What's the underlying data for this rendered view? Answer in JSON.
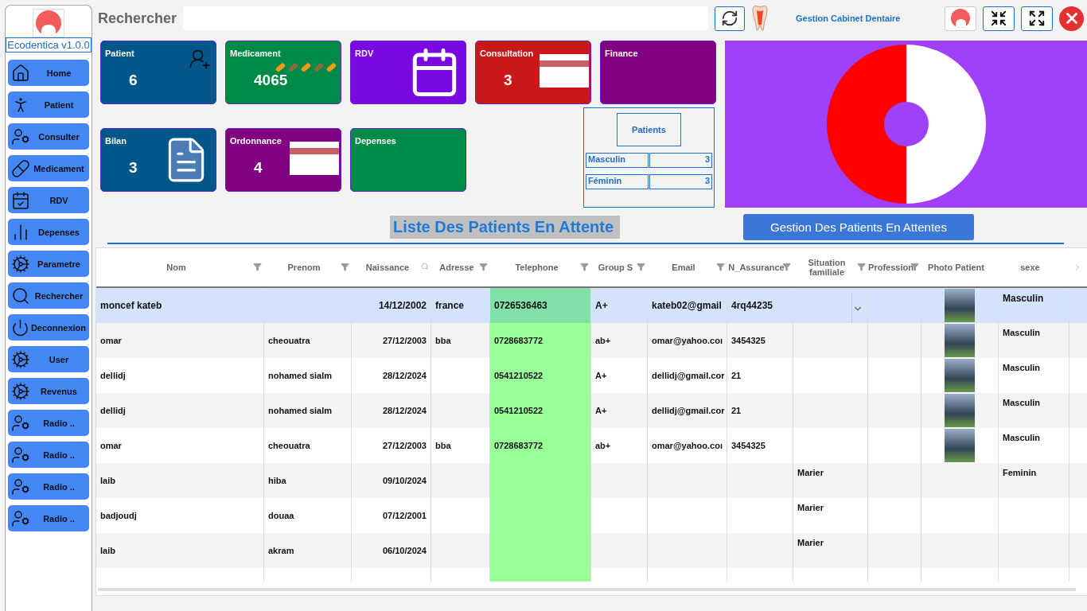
{
  "sidebar": {
    "version": "Ecodentica v1.0.0",
    "items": [
      {
        "label": "Home",
        "kind": "home"
      },
      {
        "label": "Patient",
        "kind": "walk"
      },
      {
        "label": "Consulter",
        "kind": "doctor"
      },
      {
        "label": "Medicament",
        "kind": "pill"
      },
      {
        "label": "RDV",
        "kind": "calendar"
      },
      {
        "label": "Depenses",
        "kind": "chart"
      },
      {
        "label": "Parametre",
        "kind": "gears"
      },
      {
        "label": "Rechercher",
        "kind": "search"
      },
      {
        "label": "Deconnexion",
        "kind": "power"
      },
      {
        "label": "User",
        "kind": "gears"
      },
      {
        "label": "Revenus",
        "kind": "gears"
      },
      {
        "label": "Radio ..",
        "kind": "doctor"
      },
      {
        "label": "Radio ..",
        "kind": "doctor"
      },
      {
        "label": "Radio ..",
        "kind": "doctor"
      },
      {
        "label": "Radio ..",
        "kind": "doctor"
      }
    ]
  },
  "header": {
    "search_label": "Rechercher",
    "app_title": "Gestion Cabinet Dentaire"
  },
  "tiles": [
    {
      "label": "Patient",
      "value": "6",
      "color": "#01578a",
      "kind": "user-plus"
    },
    {
      "label": "Medicament",
      "value": "4065",
      "color": "#008a48",
      "kind": "pills"
    },
    {
      "label": "RDV",
      "color": "#7a08e0",
      "kind": "calendar"
    },
    {
      "label": "Consultation",
      "value": "3",
      "color": "#c81818",
      "kind": "card"
    },
    {
      "label": "Finance",
      "color": "#800080",
      "kind": "plain"
    },
    {
      "label": "Bilan",
      "value": "3",
      "color": "#01578a",
      "kind": "document"
    },
    {
      "label": "Ordonnance",
      "value": "4",
      "color": "#800080",
      "kind": "card"
    },
    {
      "label": "Depenses",
      "color": "#008a48",
      "kind": "plain"
    }
  ],
  "patient_stats": {
    "title": "Patients",
    "rows": [
      {
        "label": "Masculin",
        "value": "3"
      },
      {
        "label": "Féminin",
        "value": "3"
      }
    ]
  },
  "waiting_list": {
    "title": "Liste Des Patients En Attente",
    "manage_button": "Gestion Des Patients En Attentes"
  },
  "table": {
    "columns": [
      {
        "label": "Nom",
        "kind": "filter"
      },
      {
        "label": "Prenom",
        "kind": "filter"
      },
      {
        "label": "Naissance",
        "kind": "search"
      },
      {
        "label": "Adresse",
        "kind": "filter"
      },
      {
        "label": "Telephone",
        "kind": "filter"
      },
      {
        "label": "Group S",
        "kind": "filter"
      },
      {
        "label": "Email",
        "kind": "filter"
      },
      {
        "label": "N_Assurance",
        "kind": "filter"
      },
      {
        "label": "Situation familiale",
        "kind": "filter"
      },
      {
        "label": "Profession",
        "kind": "filter"
      },
      {
        "label": "Photo Patient",
        "kind": "plain"
      },
      {
        "label": "sexe",
        "kind": "plain"
      }
    ],
    "rows": [
      {
        "selected": true,
        "photo": true,
        "cells": [
          "moncef kateb",
          "",
          "14/12/2002",
          "france",
          "0726536463",
          "A+",
          "kateb02@gmail",
          "4rq44235",
          "",
          "",
          "",
          "Masculin"
        ]
      },
      {
        "selected": false,
        "photo": true,
        "cells": [
          "omar",
          "cheouatra",
          "27/12/2003",
          "bba",
          "0728683772",
          "ab+",
          "omar@yahoo.coı",
          "3454325",
          "",
          "",
          "",
          "Masculin"
        ]
      },
      {
        "selected": false,
        "photo": true,
        "cells": [
          "dellidj",
          "nohamed sialm",
          "28/12/2024",
          "",
          "0541210522",
          "A+",
          "dellidj@gmail.cor",
          "21",
          "",
          "",
          "",
          "Masculin"
        ]
      },
      {
        "selected": false,
        "photo": true,
        "cells": [
          "dellidj",
          "nohamed sialm",
          "28/12/2024",
          "",
          "0541210522",
          "A+",
          "dellidj@gmail.cor",
          "21",
          "",
          "",
          "",
          "Masculin"
        ]
      },
      {
        "selected": false,
        "photo": true,
        "cells": [
          "omar",
          "cheouatra",
          "27/12/2003",
          "bba",
          "0728683772",
          "ab+",
          "omar@yahoo.coı",
          "3454325",
          "",
          "",
          "",
          "Masculin"
        ]
      },
      {
        "selected": false,
        "photo": false,
        "cells": [
          "laib",
          "hiba",
          "09/10/2024",
          "",
          "",
          "",
          "",
          "",
          "Marier",
          "",
          "",
          "Feminin"
        ]
      },
      {
        "selected": false,
        "photo": false,
        "cells": [
          "badjoudj",
          "douaa",
          "07/12/2001",
          "",
          "",
          "",
          "",
          "",
          "Marier",
          "",
          "",
          ""
        ]
      },
      {
        "selected": false,
        "photo": false,
        "cells": [
          "laib",
          "akram",
          "06/10/2024",
          "",
          "",
          "",
          "",
          "",
          "Marier",
          "",
          "",
          ""
        ]
      }
    ]
  }
}
